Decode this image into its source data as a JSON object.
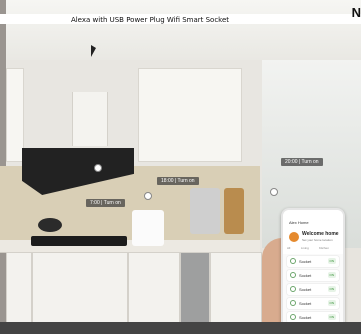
{
  "header": {
    "title": "Alexa with USB Power Plug Wifi Smart Socket",
    "brand": "N"
  },
  "timers": [
    {
      "label": "18:00 | Turn on"
    },
    {
      "label": "20:00 | Turn on"
    },
    {
      "label": "7:00 | Turn on"
    }
  ],
  "phone": {
    "user": "Alex Home",
    "welcome": "Welcome home",
    "subtitle": "Set your home location",
    "tabs": [
      "All",
      "Living",
      "Kitchen"
    ],
    "devices": [
      {
        "name": "Socket",
        "status": "ON"
      },
      {
        "name": "Socket",
        "status": "ON"
      },
      {
        "name": "Socket",
        "status": "ON"
      },
      {
        "name": "Socket",
        "status": "ON"
      },
      {
        "name": "Socket",
        "status": "ON"
      }
    ]
  },
  "colors": {
    "label_bg": "#3c3c3c",
    "accent_green": "#2d8c2d",
    "avatar": "#e58a2e"
  }
}
